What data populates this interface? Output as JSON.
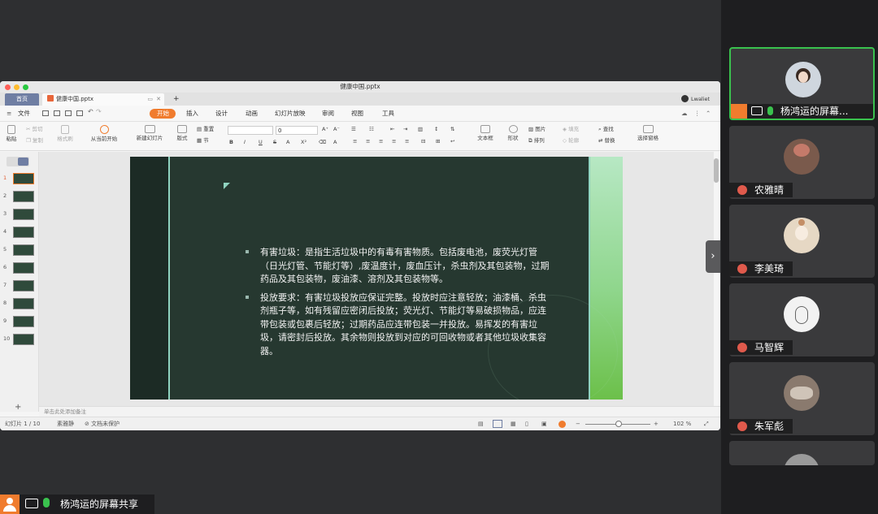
{
  "window": {
    "title": "健康中国.pptx",
    "home_tab": "首页",
    "doc_tab": "健康中国.pptx",
    "add_tab": "+",
    "user": "Lwaliet"
  },
  "menu": {
    "file": "文件",
    "items": [
      "开始",
      "插入",
      "设计",
      "动画",
      "幻灯片放映",
      "审阅",
      "视图",
      "工具"
    ],
    "active_index": 0
  },
  "toolbar": {
    "paste": "粘贴",
    "cut": "剪切",
    "copy": "复制",
    "format_painter": "格式刷",
    "from_current": "从当前开始",
    "new_slide": "新建幻灯片",
    "layout": "版式",
    "reset": "重置",
    "section": "节",
    "font_size": "0",
    "textbox": "文本框",
    "shape": "形状",
    "picture": "图片",
    "arrange": "排列",
    "fill": "填充",
    "outline": "轮廓",
    "find": "查找",
    "replace": "替换",
    "select_pane": "选择窗格"
  },
  "slide_panel": {
    "numbers": [
      "1",
      "2",
      "3",
      "4",
      "5",
      "6",
      "7",
      "8",
      "9",
      "10"
    ],
    "selected_index": 0,
    "add": "+"
  },
  "notes_placeholder": "单击此处添加备注",
  "status": {
    "slide_counter": "幻灯片 1 / 10",
    "theme": "素雅静",
    "protect": "文档未保护",
    "zoom": "102 %"
  },
  "slide": {
    "paragraph1": "有害垃圾：是指生活垃圾中的有毒有害物质。包括废电池，废荧光灯管（日光灯管、节能灯等）,废温度计，废血压计，杀虫剂及其包装物，过期药品及其包装物，废油漆、溶剂及其包装物等。",
    "paragraph2": "投放要求：有害垃圾投放应保证完整。投放时应注意轻放；油漆桶、杀虫剂瓶子等，如有残留应密闭后投放；荧光灯、节能灯等易破损物品，应连带包装或包裹后轻放；过期药品应连带包装一并投放。易挥发的有害垃圾，请密封后投放。其余物则投放到对应的可回收物或者其他垃圾收集容器。"
  },
  "screen_share_label": "杨鸿运的屏幕共享",
  "participants": [
    {
      "name": "杨鸿运的屏幕...",
      "avatar_color": "#cfd6de",
      "muted": false
    },
    {
      "name": "农雅晴",
      "avatar_color": "#7a5a4c",
      "muted": true
    },
    {
      "name": "李美琦",
      "avatar_color": "#e6d8c4",
      "muted": true
    },
    {
      "name": "马智辉",
      "avatar_color": "#f2f2f2",
      "muted": true
    },
    {
      "name": "朱军彪",
      "avatar_color": "#8a7a6e",
      "muted": true
    }
  ],
  "colors": {
    "accent_orange": "#f07c2e",
    "slide_bg": "#263830",
    "mute_red": "#e05a4c",
    "mic_green": "#3ac24e"
  }
}
